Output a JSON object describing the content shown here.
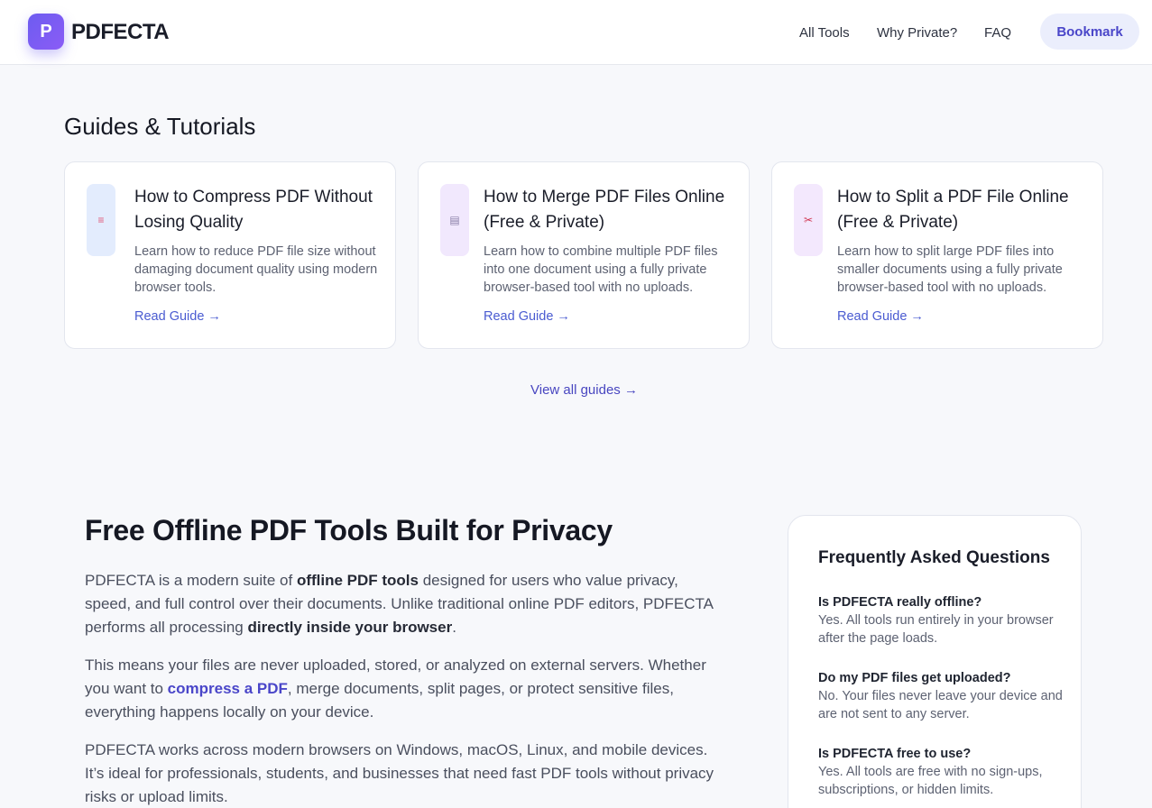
{
  "header": {
    "logo_letter": "P",
    "brand": "PDFECTA",
    "nav": [
      "All Tools",
      "Why Private?",
      "FAQ"
    ],
    "bookmark_label": "Bookmark"
  },
  "guides": {
    "title": "Guides & Tutorials",
    "cards": [
      {
        "icon": "document-icon",
        "icon_glyph": "≡",
        "title": "How to Compress PDF Without Losing Quality",
        "description": "Learn how to reduce PDF file size without damaging document quality using modern browser tools.",
        "link": "Read Guide →"
      },
      {
        "icon": "merge-document-icon",
        "icon_glyph": "▤",
        "title": "How to Merge PDF Files Online (Free & Private)",
        "description": "Learn how to combine multiple PDF files into one document using a fully private browser-based tool with no uploads.",
        "link": "Read Guide →"
      },
      {
        "icon": "scissors-icon",
        "icon_glyph": "✂",
        "title": "How to Split a PDF File Online (Free & Private)",
        "description": "Learn how to split large PDF files into smaller documents using a fully private browser-based tool with no uploads.",
        "link": "Read Guide →"
      }
    ],
    "view_all": "View all guides →"
  },
  "privacy": {
    "title": "Free Offline PDF Tools Built for Privacy",
    "p1": {
      "a": "PDFECTA is a modern suite of ",
      "b": "offline PDF tools",
      "c": " designed for users who value privacy, speed, and full control over their documents. Unlike traditional online PDF editors, PDFECTA performs all processing ",
      "d": "directly inside your browser",
      "e": "."
    },
    "p2": {
      "a": "This means your files are never uploaded, stored, or analyzed on external servers. Whether you want to ",
      "link": "compress a PDF",
      "b": ", merge documents, split pages, or protect sensitive files, everything happens locally on your device."
    },
    "p3": "PDFECTA works across modern browsers on Windows, macOS, Linux, and mobile devices. It’s ideal for professionals, students, and businesses that need fast PDF tools without privacy risks or upload limits."
  },
  "faq": {
    "title": "Frequently Asked Questions",
    "items": [
      {
        "q": "Is PDFECTA really offline?",
        "a": "Yes. All tools run entirely in your browser after the page loads."
      },
      {
        "q": "Do my PDF files get uploaded?",
        "a": "No. Your files never leave your device and are not sent to any server."
      },
      {
        "q": "Is PDFECTA free to use?",
        "a": "Yes. All tools are free with no sign-ups, subscriptions, or hidden limits."
      }
    ]
  },
  "colors": {
    "accent": "#4a46c9",
    "logo_gradient_start": "#6d5cf0",
    "logo_gradient_end": "#8b5cf6",
    "page_bg": "#f7f8fb"
  }
}
